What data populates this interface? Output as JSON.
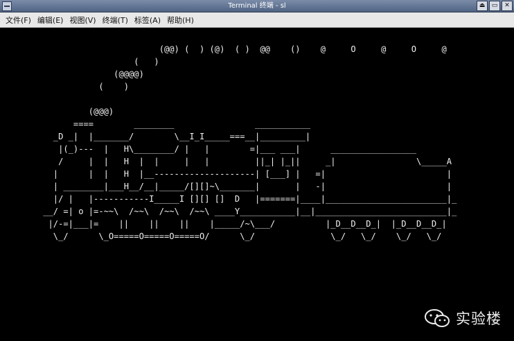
{
  "window": {
    "title": "Terminal 终端 - sl"
  },
  "titlebar": {
    "buttons": [
      "⏏",
      "▭",
      "✕"
    ]
  },
  "menu": [
    {
      "label": "文件(F)"
    },
    {
      "label": "编辑(E)"
    },
    {
      "label": "视图(V)"
    },
    {
      "label": "终端(T)"
    },
    {
      "label": "标签(A)"
    },
    {
      "label": "帮助(H)"
    }
  ],
  "terminal": {
    "lines": [
      "                               (@@) (  ) (@)  ( )  @@    ()    @     O     @     O     @",
      "                          (   )",
      "                      (@@@@)",
      "                   (    )",
      "",
      "                 (@@@)",
      "              ====        ________                ___________",
      "          _D _|  |_______/        \\__I_I_____===__|_________|",
      "           |(_)---  |   H\\________/ |   |        =|___ ___|      _________________",
      "           /     |  |   H  |  |     |   |         ||_| |_||     _|                \\_____A",
      "          |      |  |   H  |__--------------------| [___] |   =|                        |",
      "          | ________|___H__/__|_____/[][]~\\_______|       |   -|                        |",
      "          |/ |   |-----------I_____I [][] []  D   |=======|____|________________________|_",
      "        __/ =| o |=-~~\\  /~~\\  /~~\\  /~~\\ ____Y___________|__|__________________________|_",
      "         |/-=|___|=    ||    ||    ||    |_____/~\\___/          |_D__D__D_|  |_D__D__D_|",
      "          \\_/      \\_O=====O=====O=====O/      \\_/               \\_/   \\_/    \\_/   \\_/"
    ]
  },
  "watermark": {
    "text": "实验楼",
    "icon": "wechat-icon"
  }
}
